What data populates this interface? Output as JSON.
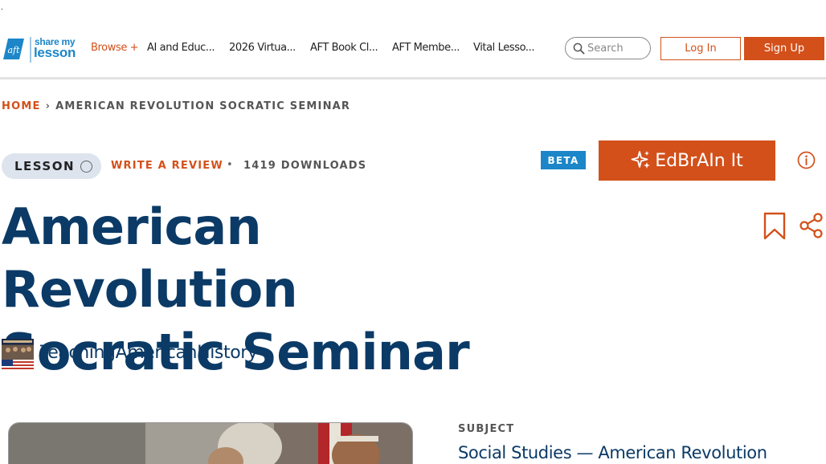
{
  "top_marker": ".",
  "logo": {
    "mark": "aft",
    "word1": "share my",
    "word2": "lesson"
  },
  "nav": {
    "browse_label": "Browse +",
    "items": [
      {
        "label": "AI and Educ..."
      },
      {
        "label": "2026 Virtua..."
      },
      {
        "label": "AFT Book Cl..."
      },
      {
        "label": "AFT Membe..."
      },
      {
        "label": "Vital Lesso..."
      }
    ]
  },
  "search": {
    "placeholder": "Search",
    "icon": "search-icon"
  },
  "auth": {
    "login_label": "Log In",
    "signup_label": "Sign Up"
  },
  "breadcrumb": {
    "home": "HOME",
    "separator": "›",
    "current": "AMERICAN REVOLUTION SOCRATIC SEMINAR"
  },
  "meta": {
    "type_badge": "LESSON",
    "review_link": "WRITE A REVIEW",
    "bullet": "•",
    "downloads": "1419 DOWNLOADS"
  },
  "ai": {
    "beta_label": "BETA",
    "button_label": "EdBrAIn It",
    "button_icon": "sparkle-icon",
    "info_icon": "info-icon"
  },
  "title": {
    "line1": "American Revolution",
    "line2": "Socratic Seminar"
  },
  "author": {
    "name": "TeachingAmericanHistory"
  },
  "subject": {
    "label": "SUBJECT",
    "value": "Social Studies — American Revolution"
  },
  "colors": {
    "accent": "#d3501a",
    "brand_blue": "#1c86c8",
    "title_navy": "#0b3a66",
    "pill_bg": "#dde4ee"
  }
}
